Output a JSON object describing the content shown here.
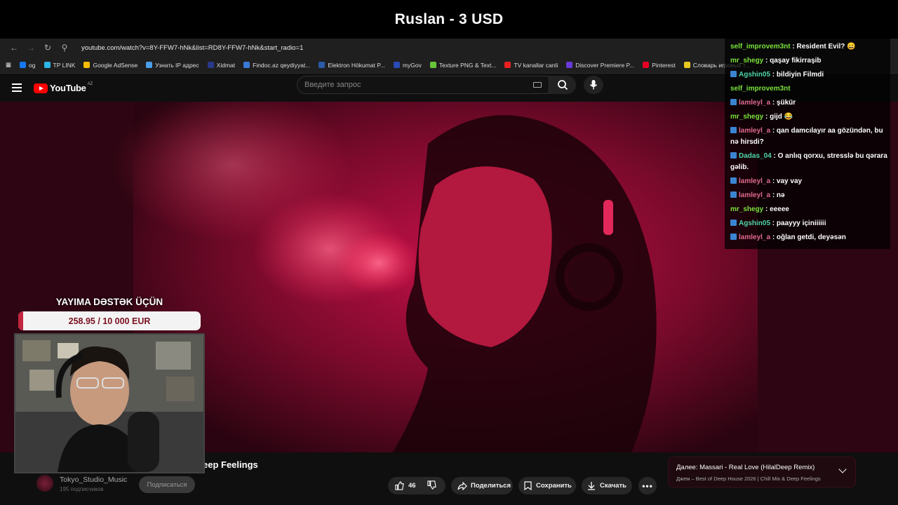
{
  "banner": {
    "title": "Ruslan - 3 USD"
  },
  "browser": {
    "url": "youtube.com/watch?v=8Y-FFW7-hNk&list=RD8Y-FFW7-hNk&start_radio=1",
    "bookmarks": [
      {
        "label": "og",
        "color": "#1877f2"
      },
      {
        "label": "TP LINK",
        "color": "#2bb5e8"
      },
      {
        "label": "Google AdSense",
        "color": "#fbbc04"
      },
      {
        "label": "Узнать IP адрес",
        "color": "#4aa0e8"
      },
      {
        "label": "Xidmat",
        "color": "#2a3a8a"
      },
      {
        "label": "Findoc.az qeydiyyat...",
        "color": "#3a7ad8"
      },
      {
        "label": "Elektron Hökumat P...",
        "color": "#2a5aa8"
      },
      {
        "label": "myGov",
        "color": "#2a4ab8"
      },
      {
        "label": "Texture PNG & Text...",
        "color": "#68c43a"
      },
      {
        "label": "TV kanallar canli",
        "color": "#e82020"
      },
      {
        "label": "Discover Premiere P...",
        "color": "#6a3ad8"
      },
      {
        "label": "Pinterest",
        "color": "#e60023"
      },
      {
        "label": "Словарь игровых т...",
        "color": "#e8c820"
      }
    ],
    "all_bookmarks": "Все закладки"
  },
  "youtube": {
    "logo": "YouTube",
    "country": "AZ",
    "search_placeholder": "Введите запрос",
    "video_title_visible": "eep Feelings",
    "channel_name": "Tokyo_Studio_Music",
    "subscribers": "195 подписчиков",
    "subscribe_label": "Подписаться",
    "likes": "46",
    "share_label": "Поделиться",
    "save_label": "Сохранить",
    "download_label": "Скачать",
    "up_next_title": "Далее: Massari - Real Love (HilalDeep Remix)",
    "up_next_sub": "Джем – Best of Deep House 2026 | Chill Mix & Deep Feelings"
  },
  "overlay": {
    "support_title": "YAYIMA DƏSTƏK ÜÇÜN",
    "support_amount": "258.95 / 10 000 EUR",
    "support_progress": 0.026,
    "accent": "#c3243e"
  },
  "chat": [
    {
      "user": "self_improvem3nt",
      "text": "Resident Evil? 😄",
      "color": "green",
      "badge": false
    },
    {
      "user": "mr_shegy",
      "text": "qaşay fikirraşib",
      "color": "green",
      "badge": false
    },
    {
      "user": "Agshin05",
      "text": "bildiyin Filmdi",
      "color": "teal",
      "badge": true
    },
    {
      "user": "self_improvem3nt",
      "text": "",
      "color": "green",
      "badge": false
    },
    {
      "user": "lamleyl_a",
      "text": "şükür",
      "color": "pink",
      "badge": true
    },
    {
      "user": "mr_shegy",
      "text": "gijd 😂",
      "color": "green",
      "badge": false
    },
    {
      "user": "lamleyl_a",
      "text": "qan damcılayır aa gözündən, bu nə hirsdi?",
      "color": "pink",
      "badge": true
    },
    {
      "user": "Dadas_04",
      "text": "O anlıq qorxu, stresslə bu qərara gəlib.",
      "color": "teal",
      "badge": true
    },
    {
      "user": "lamleyl_a",
      "text": "vay vay",
      "color": "pink",
      "badge": true
    },
    {
      "user": "lamleyl_a",
      "text": "nə",
      "color": "pink",
      "badge": true
    },
    {
      "user": "mr_shegy",
      "text": "eeeee",
      "color": "green",
      "badge": false
    },
    {
      "user": "Agshin05",
      "text": "paayyy içiniiiiii",
      "color": "teal",
      "badge": true
    },
    {
      "user": "lamleyl_a",
      "text": "oğlan getdi, deyəsən",
      "color": "pink",
      "badge": true
    }
  ]
}
